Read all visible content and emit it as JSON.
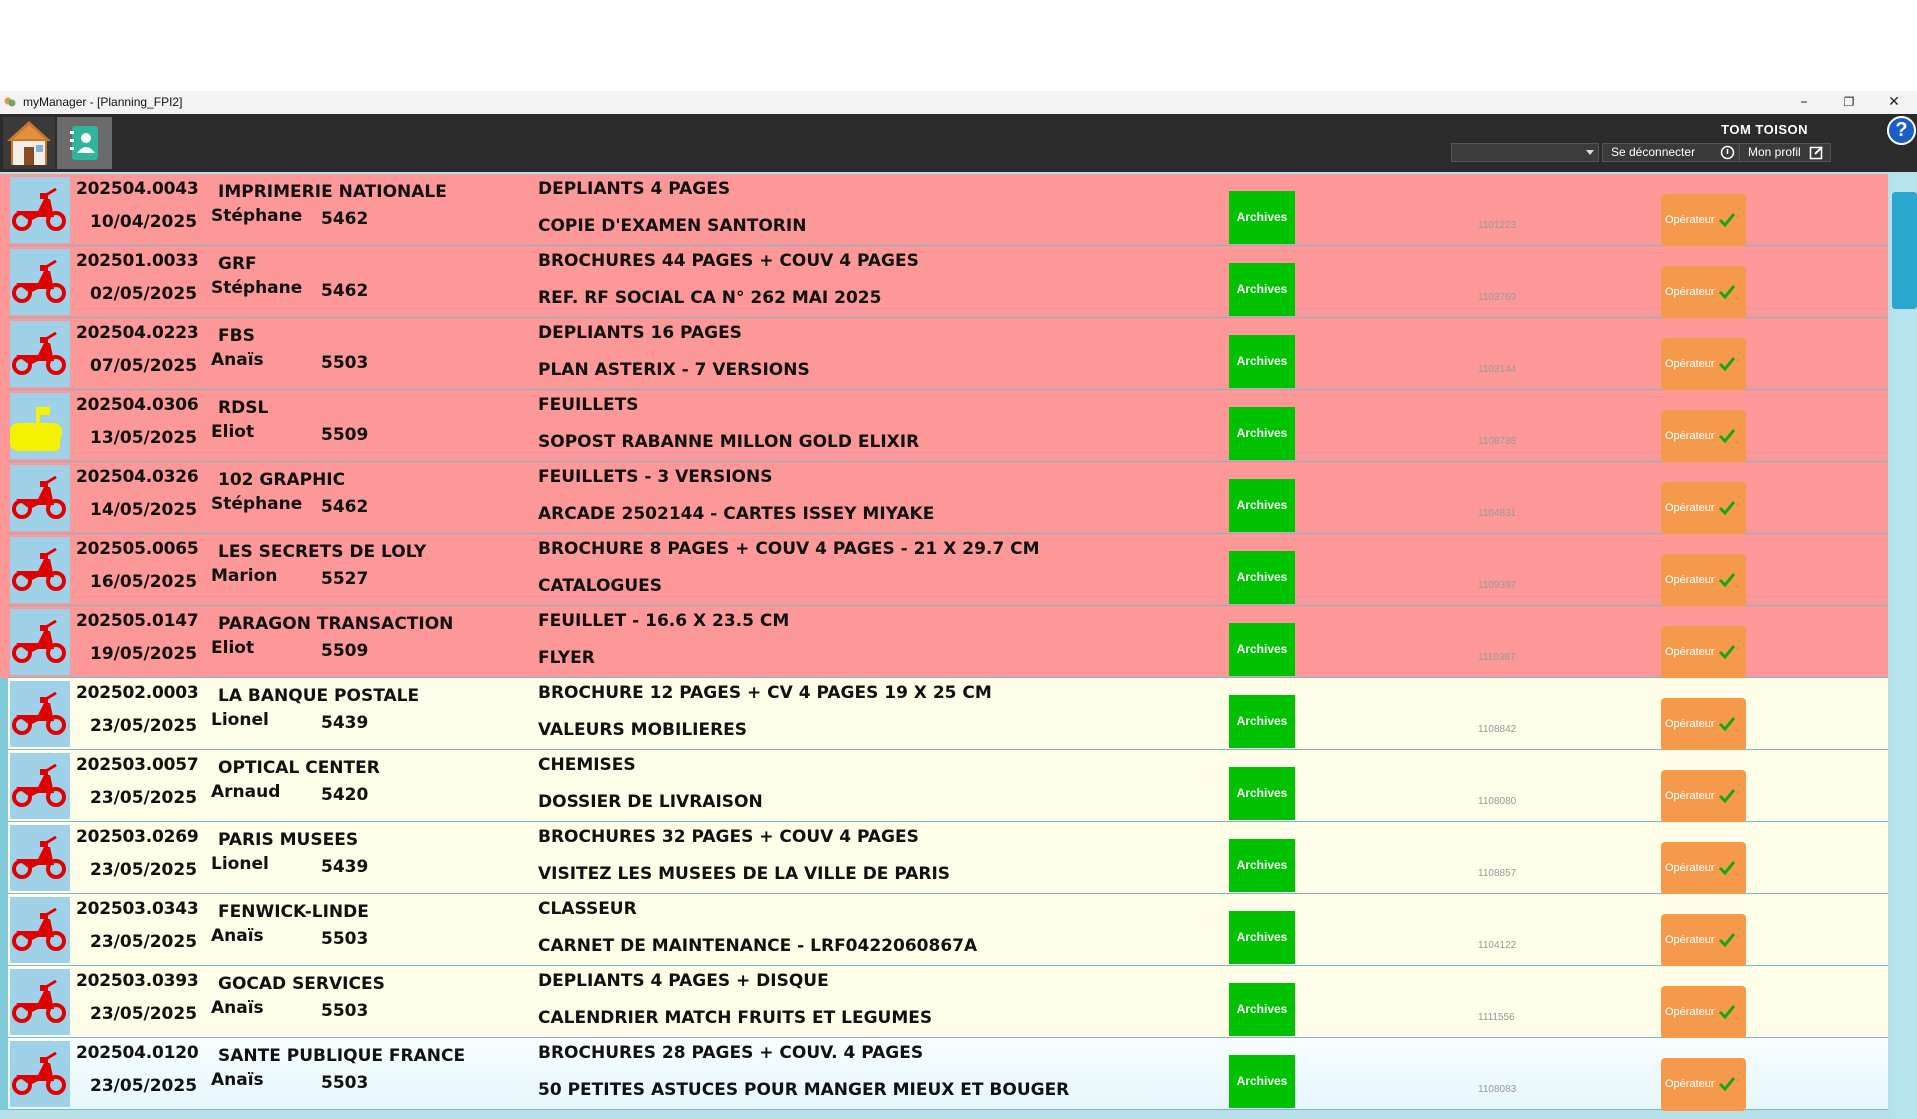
{
  "window": {
    "title": "myManager - [Planning_FPI2]",
    "minimize": "–",
    "restore": "❐",
    "close": "✕"
  },
  "toolbar": {
    "user_name": "TOM TOISON",
    "dropdown_value": "",
    "logout_label": "Se déconnecter",
    "profile_label": "Mon profil",
    "help_label": "?"
  },
  "rows": [
    {
      "status": "late",
      "icon": "scooter",
      "number": "202504.0043",
      "date": "10/04/2025",
      "client": "IMPRIMERIE NATIONALE",
      "commercial": "Stéphane",
      "code": "5462",
      "desc1": "DEPLIANTS 4 PAGES",
      "desc2": "COPIE D'EXAMEN SANTORIN",
      "archives": "Archives",
      "ref": "1101223",
      "operator": "Opérateur"
    },
    {
      "status": "late",
      "icon": "scooter",
      "number": "202501.0033",
      "date": "02/05/2025",
      "client": "GRF",
      "commercial": "Stéphane",
      "code": "5462",
      "desc1": "BROCHURES 44 PAGES + COUV 4 PAGES",
      "desc2": "REF. RF SOCIAL CA N° 262 MAI 2025",
      "archives": "Archives",
      "ref": "1103769",
      "operator": "Opérateur"
    },
    {
      "status": "late",
      "icon": "scooter",
      "number": "202504.0223",
      "date": "07/05/2025",
      "client": "FBS",
      "commercial": "Anaïs",
      "code": "5503",
      "desc1": "DEPLIANTS 16 PAGES",
      "desc2": "PLAN ASTERIX - 7 VERSIONS",
      "archives": "Archives",
      "ref": "1103144",
      "operator": "Opérateur"
    },
    {
      "status": "late",
      "icon": "mailbox",
      "number": "202504.0306",
      "date": "13/05/2025",
      "client": "RDSL",
      "commercial": "Eliot",
      "code": "5509",
      "desc1": "FEUILLETS",
      "desc2": "SOPOST RABANNE MILLON GOLD ELIXIR",
      "archives": "Archives",
      "ref": "1108788",
      "operator": "Opérateur"
    },
    {
      "status": "late",
      "icon": "scooter",
      "number": "202504.0326",
      "date": "14/05/2025",
      "client": "102 GRAPHIC",
      "commercial": "Stéphane",
      "code": "5462",
      "desc1": "FEUILLETS - 3 VERSIONS",
      "desc2": "ARCADE 2502144 - CARTES ISSEY MIYAKE",
      "archives": "Archives",
      "ref": "1104831",
      "operator": "Opérateur"
    },
    {
      "status": "late",
      "icon": "scooter",
      "number": "202505.0065",
      "date": "16/05/2025",
      "client": "LES SECRETS DE LOLY",
      "commercial": "Marion",
      "code": "5527",
      "desc1": "BROCHURE 8 PAGES + COUV 4 PAGES - 21 X 29.7 CM",
      "desc2": "CATALOGUES",
      "archives": "Archives",
      "ref": "1109397",
      "operator": "Opérateur"
    },
    {
      "status": "late",
      "icon": "scooter",
      "number": "202505.0147",
      "date": "19/05/2025",
      "client": "PARAGON TRANSACTION",
      "commercial": "Eliot",
      "code": "5509",
      "desc1": "FEUILLET - 16.6 X 23.5 CM",
      "desc2": "FLYER",
      "archives": "Archives",
      "ref": "1110387",
      "operator": "Opérateur"
    },
    {
      "status": "normal",
      "icon": "scooter",
      "number": "202502.0003",
      "date": "23/05/2025",
      "client": "LA BANQUE POSTALE",
      "commercial": "Lionel",
      "code": "5439",
      "desc1": "BROCHURE 12 PAGES + CV 4 PAGES 19 X 25 CM",
      "desc2": "VALEURS MOBILIERES",
      "archives": "Archives",
      "ref": "1108842",
      "operator": "Opérateur"
    },
    {
      "status": "normal",
      "icon": "scooter",
      "number": "202503.0057",
      "date": "23/05/2025",
      "client": "OPTICAL CENTER",
      "commercial": "Arnaud",
      "code": "5420",
      "desc1": "CHEMISES",
      "desc2": "DOSSIER DE LIVRAISON",
      "archives": "Archives",
      "ref": "1108080",
      "operator": "Opérateur"
    },
    {
      "status": "normal",
      "icon": "scooter",
      "number": "202503.0269",
      "date": "23/05/2025",
      "client": "PARIS MUSEES",
      "commercial": "Lionel",
      "code": "5439",
      "desc1": "BROCHURES 32 PAGES + COUV 4 PAGES",
      "desc2": "VISITEZ LES MUSEES DE LA VILLE DE PARIS",
      "archives": "Archives",
      "ref": "1108857",
      "operator": "Opérateur"
    },
    {
      "status": "normal",
      "icon": "scooter",
      "number": "202503.0343",
      "date": "23/05/2025",
      "client": "FENWICK-LINDE",
      "commercial": "Anaïs",
      "code": "5503",
      "desc1": "CLASSEUR",
      "desc2": "CARNET DE MAINTENANCE - LRF0422060867A",
      "archives": "Archives",
      "ref": "1104122",
      "operator": "Opérateur"
    },
    {
      "status": "normal",
      "icon": "scooter",
      "number": "202503.0393",
      "date": "23/05/2025",
      "client": "GOCAD SERVICES",
      "commercial": "Anaïs",
      "code": "5503",
      "desc1": "DEPLIANTS 4 PAGES + DISQUE",
      "desc2": "CALENDRIER MATCH FRUITS ET LEGUMES",
      "archives": "Archives",
      "ref": "1111556",
      "operator": "Opérateur"
    },
    {
      "status": "sel",
      "icon": "scooter",
      "number": "202504.0120",
      "date": "23/05/2025",
      "client": "SANTE PUBLIQUE FRANCE",
      "commercial": "Anaïs",
      "code": "5503",
      "desc1": "BROCHURES 28 PAGES + COUV. 4 PAGES",
      "desc2": "50 PETITES ASTUCES POUR MANGER MIEUX ET BOUGER",
      "archives": "Archives",
      "ref": "1108083",
      "operator": "Opérateur"
    }
  ],
  "colors": {
    "late_row": "#fd9898",
    "normal_row": "#fefde8",
    "archives": "#00c200",
    "operator": "#f59a4d",
    "toolbar": "#2b2b2b",
    "scroll_thumb": "#2aa7cf"
  }
}
